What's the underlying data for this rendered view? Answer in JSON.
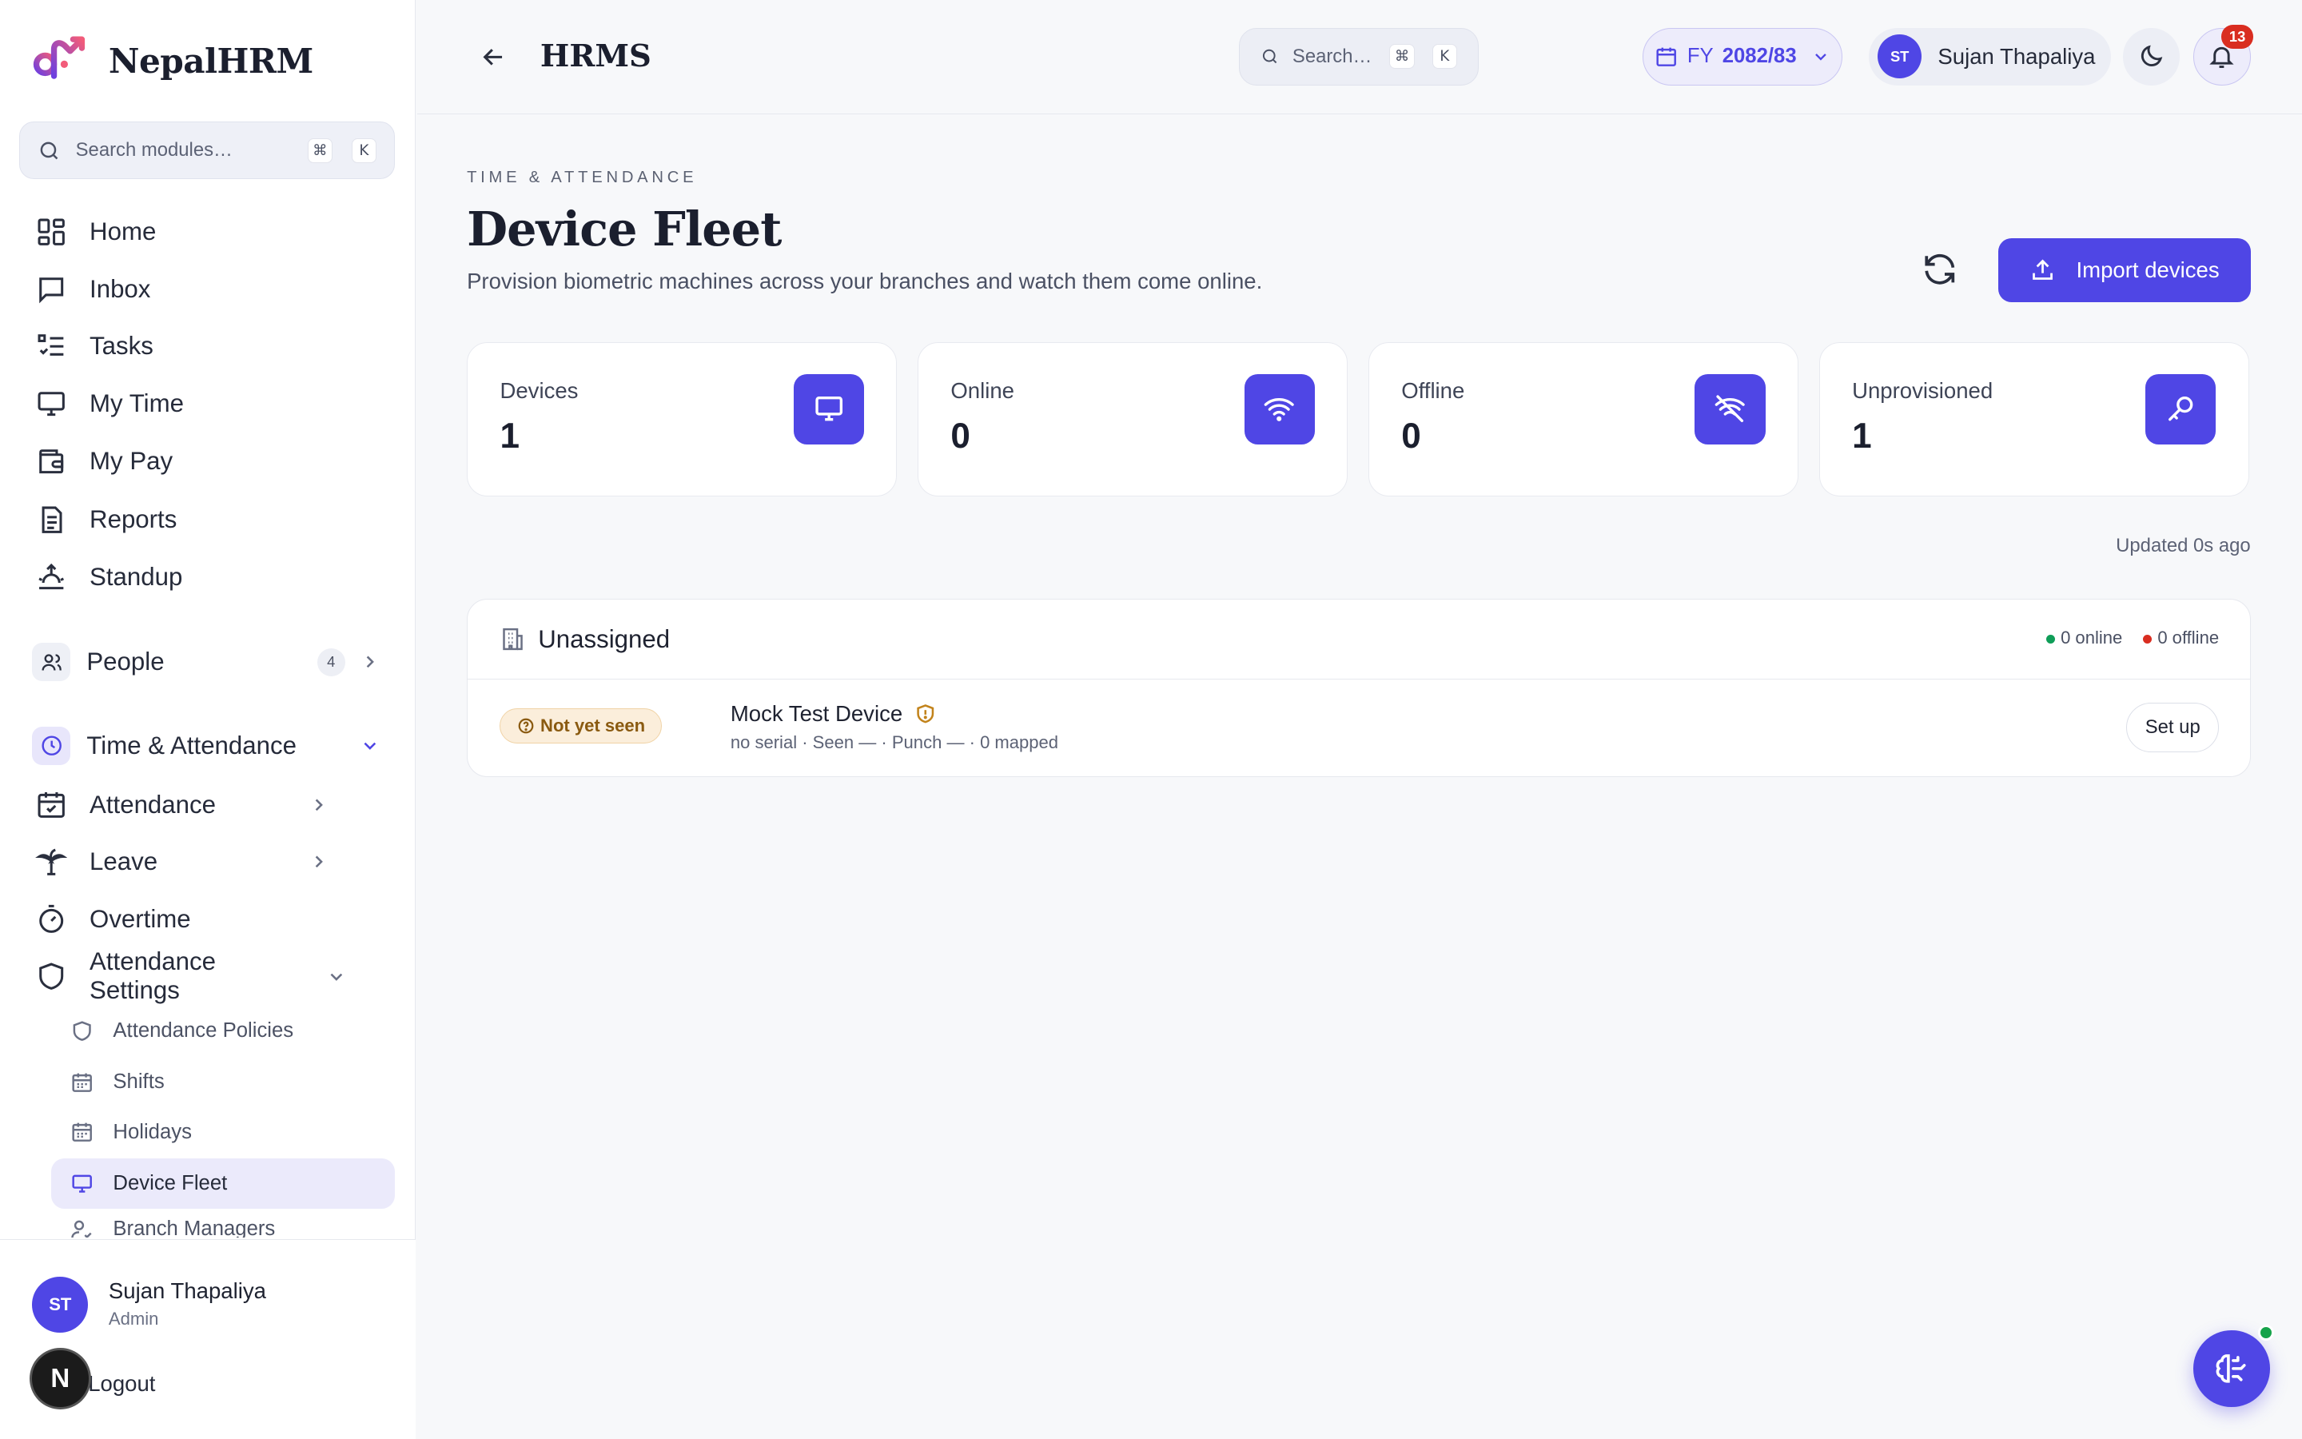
{
  "brand": {
    "name": "NepalHRM"
  },
  "sidebar": {
    "search": {
      "placeholder": "Search modules…",
      "key1": "⌘",
      "key2": "K"
    },
    "items": [
      {
        "label": "Home",
        "icon": "dashboard-icon"
      },
      {
        "label": "Inbox",
        "icon": "message-icon"
      },
      {
        "label": "Tasks",
        "icon": "checklist-icon"
      },
      {
        "label": "My Time",
        "icon": "monitor-icon"
      },
      {
        "label": "My Pay",
        "icon": "wallet-icon"
      },
      {
        "label": "Reports",
        "icon": "document-icon"
      },
      {
        "label": "Standup",
        "icon": "sunrise-icon"
      }
    ],
    "people": {
      "label": "People",
      "count": "4"
    },
    "time_attendance": {
      "label": "Time & Attendance",
      "items": [
        {
          "label": "Attendance"
        },
        {
          "label": "Leave"
        },
        {
          "label": "Overtime"
        },
        {
          "label": "Attendance Settings"
        }
      ],
      "settings_sub": [
        {
          "label": "Attendance Policies"
        },
        {
          "label": "Shifts"
        },
        {
          "label": "Holidays"
        },
        {
          "label": "Device Fleet"
        },
        {
          "label": "Branch Managers"
        }
      ]
    },
    "footer": {
      "initials": "ST",
      "name": "Sujan Thapaliya",
      "role": "Admin",
      "logout": "Logout",
      "next_badge": "N"
    }
  },
  "topbar": {
    "title": "HRMS",
    "search": {
      "placeholder": "Search…",
      "key1": "⌘",
      "key2": "K"
    },
    "fy": {
      "prefix": "FY",
      "value": "2082/83"
    },
    "user": {
      "initials": "ST",
      "name": "Sujan Thapaliya"
    },
    "notifications": "13"
  },
  "page": {
    "eyebrow": "TIME & ATTENDANCE",
    "title": "Device Fleet",
    "subtitle": "Provision biometric machines across your branches and watch them come online.",
    "import_label": "Import devices",
    "updated": "Updated 0s ago"
  },
  "stats": [
    {
      "label": "Devices",
      "value": "1",
      "icon": "monitor-icon"
    },
    {
      "label": "Online",
      "value": "0",
      "icon": "wifi-icon"
    },
    {
      "label": "Offline",
      "value": "0",
      "icon": "wifi-off-icon"
    },
    {
      "label": "Unprovisioned",
      "value": "1",
      "icon": "key-icon"
    }
  ],
  "group": {
    "title": "Unassigned",
    "online": "0 online",
    "offline": "0 offline",
    "device": {
      "status": "Not yet seen",
      "name": "Mock Test Device",
      "meta": "no serial · Seen — · Punch — · 0 mapped",
      "action": "Set up"
    }
  },
  "colors": {
    "accent": "#4f46e5",
    "online": "#0f9d58",
    "offline": "#d92d20",
    "warning_bg": "#fbeedb"
  }
}
